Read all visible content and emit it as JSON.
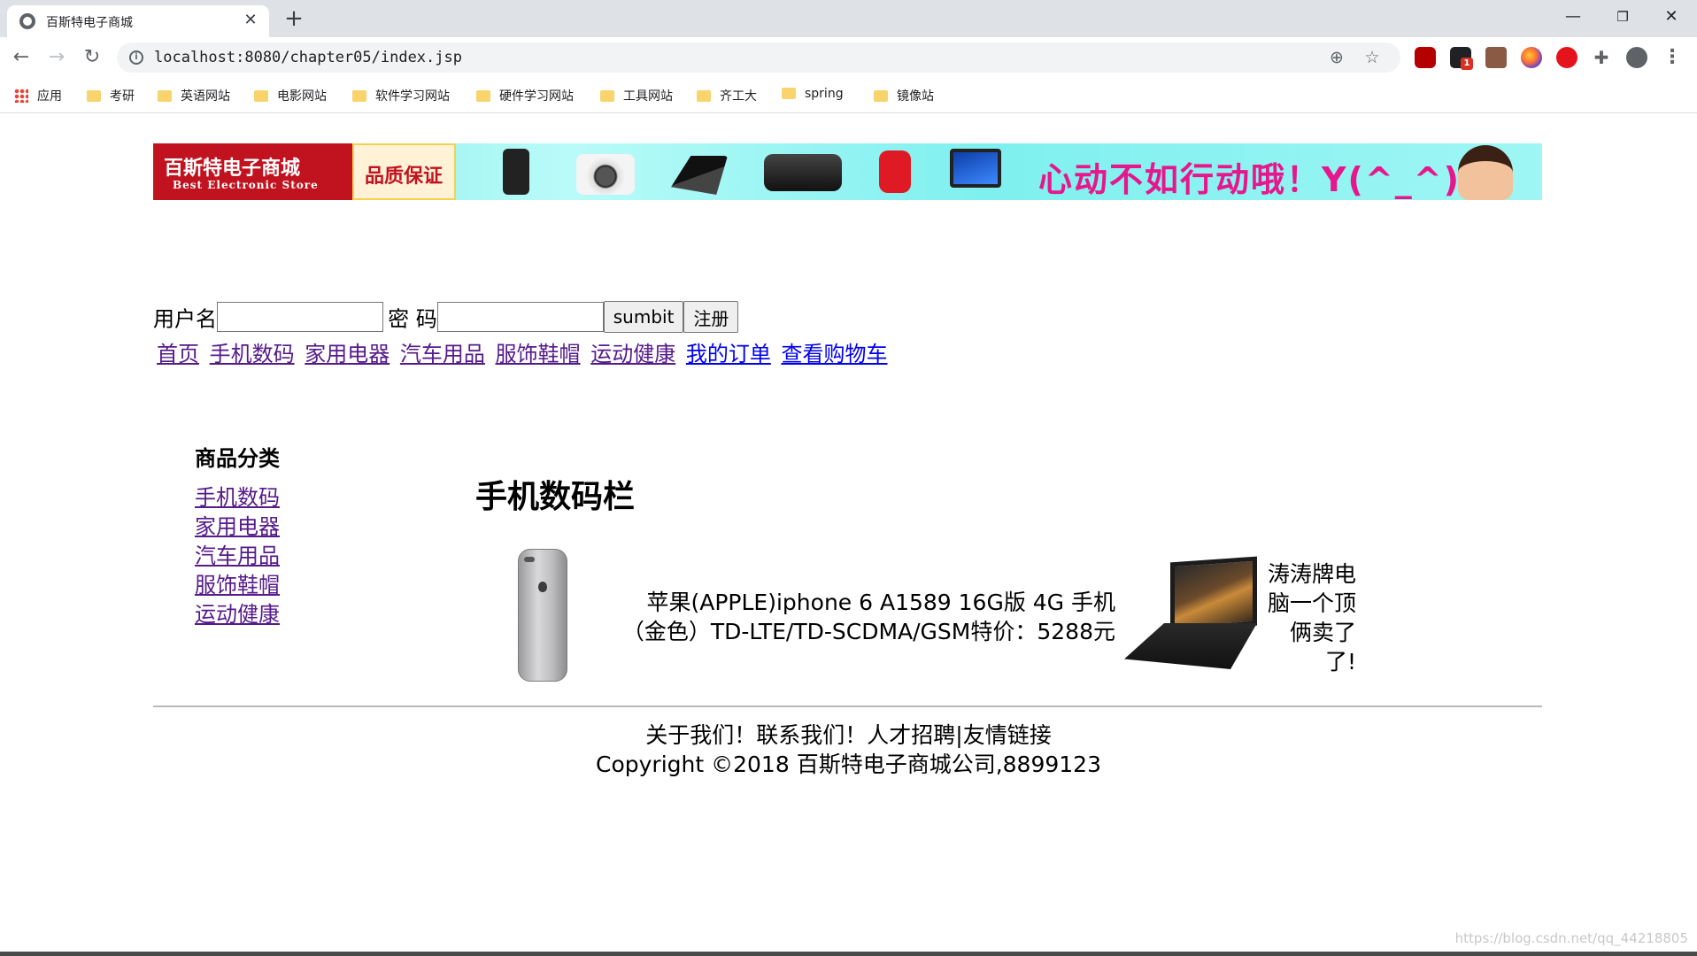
{
  "browser": {
    "tab_title": "百斯特电子商城",
    "tab_close": "✕",
    "new_tab": "+",
    "window_controls": {
      "minimize": "—",
      "restore": "❐",
      "close": "✕"
    },
    "nav": {
      "back": "←",
      "forward": "→",
      "reload": "↻"
    },
    "url": "localhost:8080/chapter05/index.jsp",
    "omnibox_icons": {
      "info": "i",
      "zoom": "⊕",
      "bookmark_star": "☆"
    },
    "extensions": [
      "ublock-origin-icon",
      "extension-badge-icon",
      "extension-icon",
      "firefox-icon",
      "opera-icon",
      "puzzle-icon",
      "profile-icon",
      "more-icon"
    ],
    "extension_badge": "1",
    "puzzle": "✚",
    "menu": "⋮",
    "bookmarks": [
      "应用",
      "考研",
      "英语网站",
      "电影网站",
      "软件学习网站",
      "硬件学习网站",
      "工具网站",
      "齐工大",
      "spring",
      "镜像站"
    ]
  },
  "banner": {
    "logo_title": "百斯特电子商城",
    "logo_subtitle": "Best Electronic Store",
    "quality": "品质保证",
    "slogan": "心动不如行动哦！Y(^_^)Y"
  },
  "login": {
    "username_label": "用户名",
    "password_label": "密 码",
    "submit_label": "sumbit",
    "register_label": "注册"
  },
  "top_nav": [
    "首页",
    "手机数码",
    "家用电器",
    "汽车用品",
    "服饰鞋帽",
    "运动健康",
    "我的订单",
    "查看购物车"
  ],
  "sidebar": {
    "title": "商品分类",
    "items": [
      "手机数码",
      "家用电器",
      "汽车用品",
      "服饰鞋帽",
      "运动健康"
    ]
  },
  "main": {
    "title": "手机数码栏",
    "products": [
      {
        "description": "苹果(APPLE)iphone 6 A1589 16G版 4G 手机（金色）TD-LTE/TD-SCDMA/GSM特价：5288元"
      },
      {
        "description": "涛涛牌电脑一个顶俩卖了了!"
      }
    ]
  },
  "footer": {
    "links": "关于我们！联系我们！人才招聘|友情链接",
    "copyright": "Copyright ©2018 百斯特电子商城公司,8899123"
  },
  "watermark": "https://blog.csdn.net/qq_44218805",
  "colors": {
    "link_visited": "#551a8b",
    "link_unvisited": "#0000ee",
    "banner_red": "#c1131f",
    "banner_cyan": "#7ce9e8",
    "slogan_pink": "#e8168c"
  }
}
